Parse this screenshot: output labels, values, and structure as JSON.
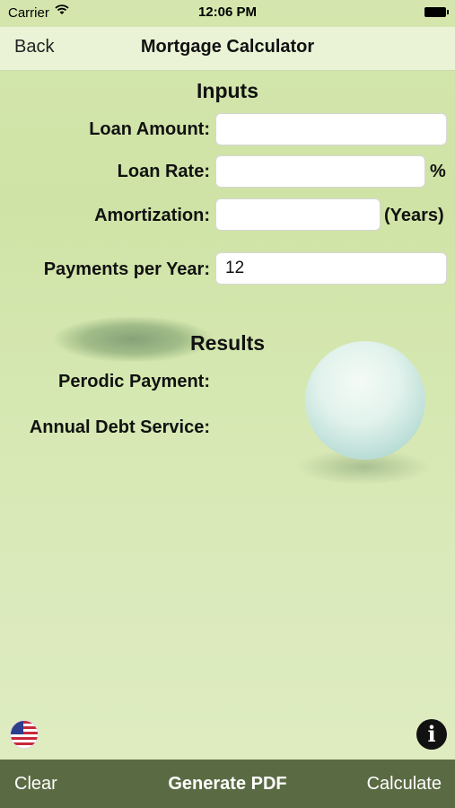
{
  "status_bar": {
    "carrier": "Carrier",
    "time": "12:06 PM"
  },
  "nav": {
    "back_label": "Back",
    "title": "Mortgage Calculator"
  },
  "inputs": {
    "section_title": "Inputs",
    "loan_amount_label": "Loan Amount:",
    "loan_amount_value": "",
    "loan_rate_label": "Loan Rate:",
    "loan_rate_value": "",
    "loan_rate_suffix": "%",
    "amortization_label": "Amortization:",
    "amortization_value": "",
    "amortization_suffix": "(Years)",
    "payments_label": "Payments per Year:",
    "payments_value": "12"
  },
  "results": {
    "section_title": "Results",
    "periodic_payment_label": "Perodic Payment:",
    "annual_debt_label": "Annual Debt Service:"
  },
  "icons": {
    "flag": "us-flag-icon",
    "info": "info-icon",
    "info_glyph": "i"
  },
  "toolbar": {
    "clear_label": "Clear",
    "pdf_label": "Generate PDF",
    "calculate_label": "Calculate"
  },
  "colors": {
    "toolbar_bg": "#5a6b43",
    "toolbar_text": "#ffffff"
  }
}
